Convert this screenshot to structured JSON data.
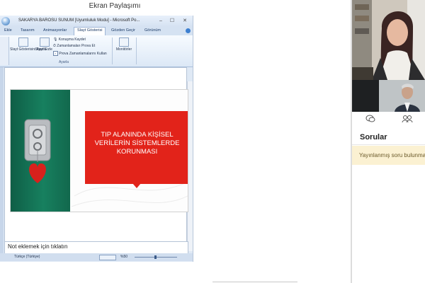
{
  "screen_title": "Ekran Paylaşımı",
  "ppt": {
    "doc_title": "SAKARYA BAROSU SUNUM [Uyumluluk Modu] - Microsoft Po...",
    "tabs": [
      "Ekle",
      "Tasarım",
      "Animasyonlar",
      "Slayt Gösterisi",
      "Gözden Geçir",
      "Görünüm"
    ],
    "active_tab": "Slayt Gösterisi",
    "ribbon": {
      "slide_show_setup": "Slayt Gösterisini Ayarla",
      "hide_slide": "Slayt Gizle",
      "record_narration": "Konuşma Kaydet",
      "rehearse_timings": "Zamanlamaları Prova Et",
      "use_rehearsed_timings": "Prova Zamanlamalarını Kullan",
      "monitors": "Monitörler",
      "group_label": "Ayarla"
    },
    "slide_text": "TIP ALANINDA KİŞİSEL VERİLERİN SİSTEMLERDE KORUNMASI",
    "notes_placeholder": "Not eklemek için tıklatın",
    "status_language": "Türkçe (Türkiye)",
    "zoom": "%50"
  },
  "side_panel": {
    "section_title": "Sorular",
    "notice": "Yayınlanmış soru bulunma"
  },
  "colors": {
    "slide_red": "#e2231a",
    "slide_green": "#17805f",
    "notice_bg": "#fbf1d2"
  }
}
